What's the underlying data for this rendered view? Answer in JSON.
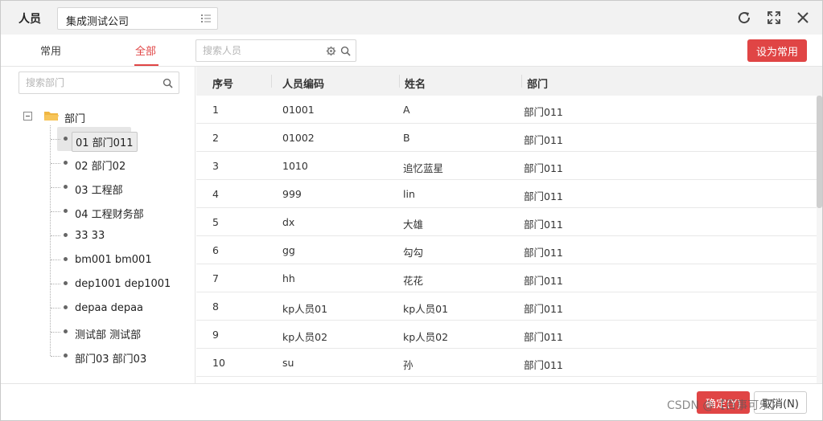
{
  "header": {
    "title": "人员",
    "company": "集成测试公司"
  },
  "tabs": [
    {
      "label": "常用",
      "active": false
    },
    {
      "label": "全部",
      "active": true
    }
  ],
  "search_person": {
    "placeholder": "搜索人员",
    "value": ""
  },
  "set_common_label": "设为常用",
  "search_dept": {
    "placeholder": "搜索部门",
    "value": ""
  },
  "tree": {
    "root": "部门",
    "nodes": [
      {
        "label": "01 部门011",
        "selected": true
      },
      {
        "label": "02 部门02",
        "selected": false
      },
      {
        "label": "03 工程部",
        "selected": false
      },
      {
        "label": "04 工程财务部",
        "selected": false
      },
      {
        "label": "33 33",
        "selected": false
      },
      {
        "label": "bm001 bm001",
        "selected": false
      },
      {
        "label": "dep1001 dep1001",
        "selected": false
      },
      {
        "label": "depaa depaa",
        "selected": false
      },
      {
        "label": "测试部 测试部",
        "selected": false
      },
      {
        "label": "部门03 部门03",
        "selected": false
      }
    ]
  },
  "table": {
    "columns": [
      "序号",
      "人员编码",
      "姓名",
      "部门"
    ],
    "rows": [
      {
        "no": "1",
        "code": "01001",
        "name": "A",
        "dept": "部门011"
      },
      {
        "no": "2",
        "code": "01002",
        "name": "B",
        "dept": "部门011"
      },
      {
        "no": "3",
        "code": "1010",
        "name": "追忆蓝星",
        "dept": "部门011"
      },
      {
        "no": "4",
        "code": "999",
        "name": "lin",
        "dept": "部门011"
      },
      {
        "no": "5",
        "code": "dx",
        "name": "大雄",
        "dept": "部门011"
      },
      {
        "no": "6",
        "code": "gg",
        "name": "勾勾",
        "dept": "部门011"
      },
      {
        "no": "7",
        "code": "hh",
        "name": "花花",
        "dept": "部门011"
      },
      {
        "no": "8",
        "code": "kp人员01",
        "name": "kp人员01",
        "dept": "部门011"
      },
      {
        "no": "9",
        "code": "kp人员02",
        "name": "kp人员02",
        "dept": "部门011"
      },
      {
        "no": "10",
        "code": "su",
        "name": "孙",
        "dept": "部门011"
      }
    ]
  },
  "footer": {
    "ok_label": "确定(Y)",
    "cancel_label": "取消(N)"
  },
  "watermark": "CSDN @【百事可乐】",
  "colors": {
    "accent": "#e04545",
    "header_bg": "#f2f2f2"
  },
  "icons": [
    "list-icon",
    "refresh-icon",
    "fullscreen-icon",
    "close-icon",
    "gear-icon",
    "search-icon",
    "folder-icon",
    "collapse-icon"
  ]
}
